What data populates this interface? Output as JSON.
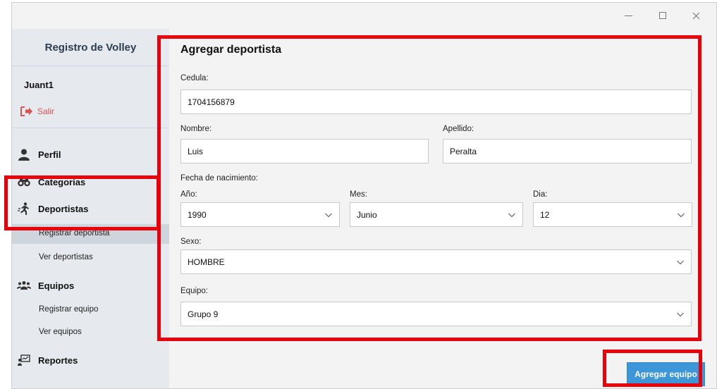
{
  "window": {
    "controls": [
      "minimize-icon",
      "maximize-icon",
      "close-icon"
    ]
  },
  "sidebar": {
    "title": "Registro de Volley",
    "user": "Juant1",
    "logout_label": "Salir",
    "items": [
      {
        "label": "Perfil",
        "icon": "user-icon"
      },
      {
        "label": "Categorias",
        "icon": "binoculars-icon"
      },
      {
        "label": "Deportistas",
        "icon": "runner-icon",
        "sub": [
          "Registrar deportista",
          "Ver deportistas"
        ]
      },
      {
        "label": "Equipos",
        "icon": "group-icon",
        "sub": [
          "Registrar equipo",
          "Ver equipos"
        ]
      },
      {
        "label": "Reportes",
        "icon": "report-icon"
      }
    ],
    "active_sub": "Registrar deportista"
  },
  "form": {
    "title": "Agregar deportista",
    "cedula": {
      "label": "Cedula:",
      "value": "1704156879"
    },
    "nombre": {
      "label": "Nombre:",
      "value": "Luis"
    },
    "apellido": {
      "label": "Apellido:",
      "value": "Peralta"
    },
    "fecha_label": "Fecha de nacimiento:",
    "anio": {
      "label": "Año:",
      "value": "1990"
    },
    "mes": {
      "label": "Mes:",
      "value": "Junio"
    },
    "dia": {
      "label": "Dia:",
      "value": "12"
    },
    "sexo": {
      "label": "Sexo:",
      "value": "HOMBRE"
    },
    "equipo": {
      "label": "Equipo:",
      "value": "Grupo 9"
    },
    "submit_label": "Agregar equipo"
  },
  "colors": {
    "accent": "#3d96d8",
    "highlight": "#e8000b",
    "logout": "#d9534f",
    "sidebar_bg": "#e6e9ee"
  }
}
